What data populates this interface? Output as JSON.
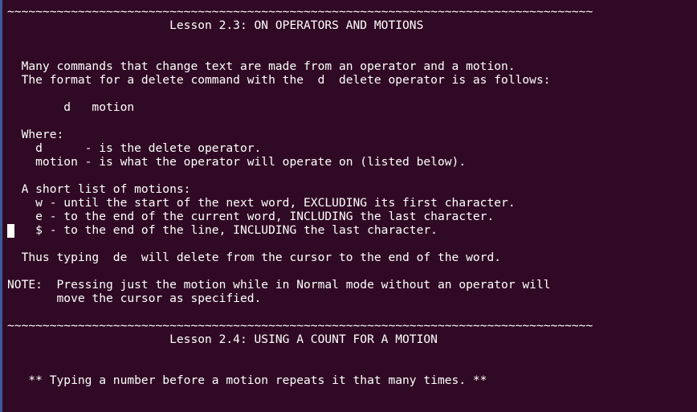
{
  "terminal": {
    "colors": {
      "background": "#300a24",
      "text": "#ffffff",
      "left_edge": "#3b5a99"
    },
    "lines": [
      "~~~~~~~~~~~~~~~~~~~~~~~~~~~~~~~~~~~~~~~~~~~~~~~~~~~~~~~~~~~~~~~~~~~~~~~~~~~~~~~~~~~",
      "                       Lesson 2.3: ON OPERATORS AND MOTIONS",
      "",
      "",
      "  Many commands that change text are made from an operator and a motion.",
      "  The format for a delete command with the  d  delete operator is as follows:",
      "",
      "        d   motion",
      "",
      "  Where:",
      "    d      - is the delete operator.",
      "    motion - is what the operator will operate on (listed below).",
      "",
      "  A short list of motions:",
      "    w - until the start of the next word, EXCLUDING its first character.",
      "    e - to the end of the current word, INCLUDING the last character.",
      "    $ - to the end of the line, INCLUDING the last character.",
      "",
      "  Thus typing  de  will delete from the cursor to the end of the word.",
      "",
      "NOTE:  Pressing just the motion while in Normal mode without an operator will",
      "       move the cursor as specified.",
      "",
      "~~~~~~~~~~~~~~~~~~~~~~~~~~~~~~~~~~~~~~~~~~~~~~~~~~~~~~~~~~~~~~~~~~~~~~~~~~~~~~~~~~~",
      "                       Lesson 2.4: USING A COUNT FOR A MOTION",
      "",
      "",
      "   ** Typing a number before a motion repeats it that many times. **"
    ]
  }
}
